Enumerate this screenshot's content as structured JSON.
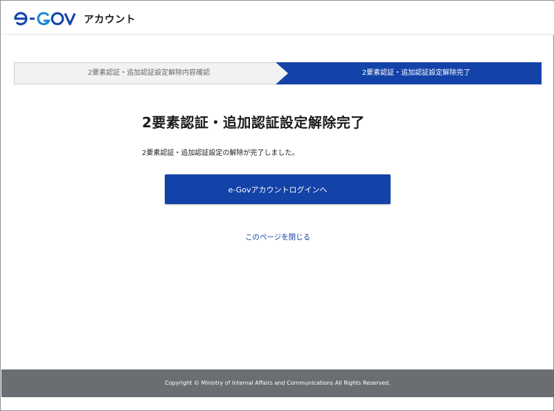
{
  "header": {
    "logo_alt": "e-GOV",
    "service_name": "アカウント"
  },
  "steps": [
    {
      "label": "2要素認証・追加認証設定解除内容確認",
      "active": false
    },
    {
      "label": "2要素認証・追加認証設定解除完了",
      "active": true
    }
  ],
  "main": {
    "title": "2要素認証・追加認証設定解除完了",
    "message": "2要素認証・追加認証設定の解除が完了しました。",
    "login_button": "e-Govアカウントログインへ",
    "close_link": "このページを閉じる"
  },
  "footer": {
    "copyright": "Copyright © Ministry of Internal Affairs and Communications All Rights Reserved."
  },
  "colors": {
    "brand_blue": "#1343a8",
    "step_inactive_bg": "#f2f2f2",
    "footer_bg": "#6a6e73"
  }
}
